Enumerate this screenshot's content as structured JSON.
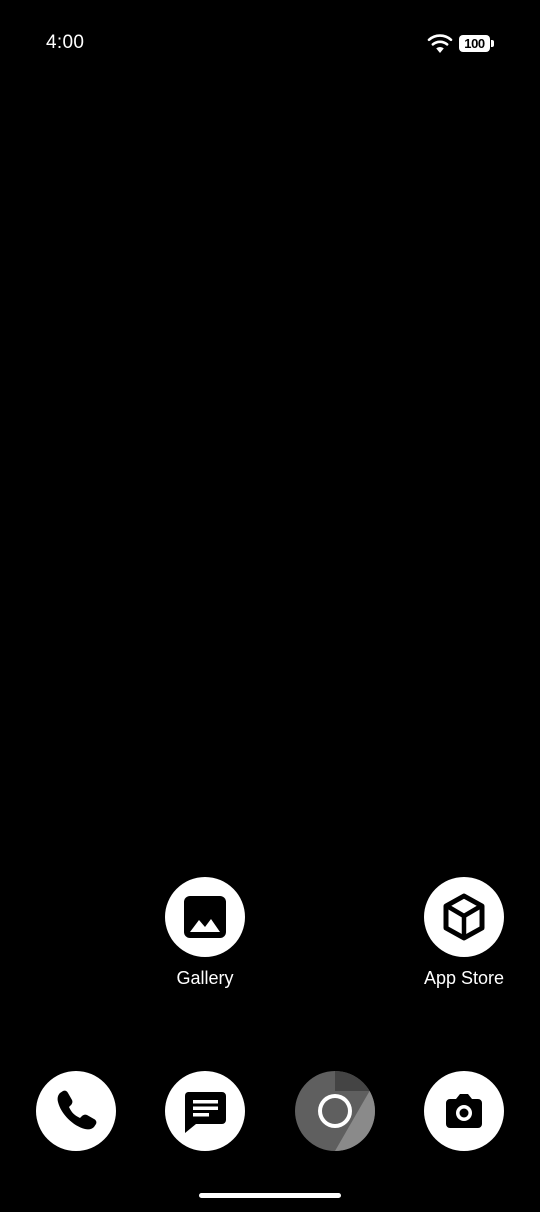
{
  "status_bar": {
    "time": "4:00",
    "battery_level": "100",
    "wifi_icon": "wifi-icon"
  },
  "home_apps": [
    {
      "label": "Gallery",
      "icon": "gallery-icon"
    },
    {
      "label": "App Store",
      "icon": "app-store-icon"
    }
  ],
  "dock": [
    {
      "icon": "phone-icon"
    },
    {
      "icon": "messages-icon"
    },
    {
      "icon": "browser-icon"
    },
    {
      "icon": "camera-icon"
    }
  ],
  "colors": {
    "background": "#000000",
    "icon_background": "#ffffff",
    "icon_glyph": "#000000",
    "browser_icon": "#5f5f5f"
  }
}
